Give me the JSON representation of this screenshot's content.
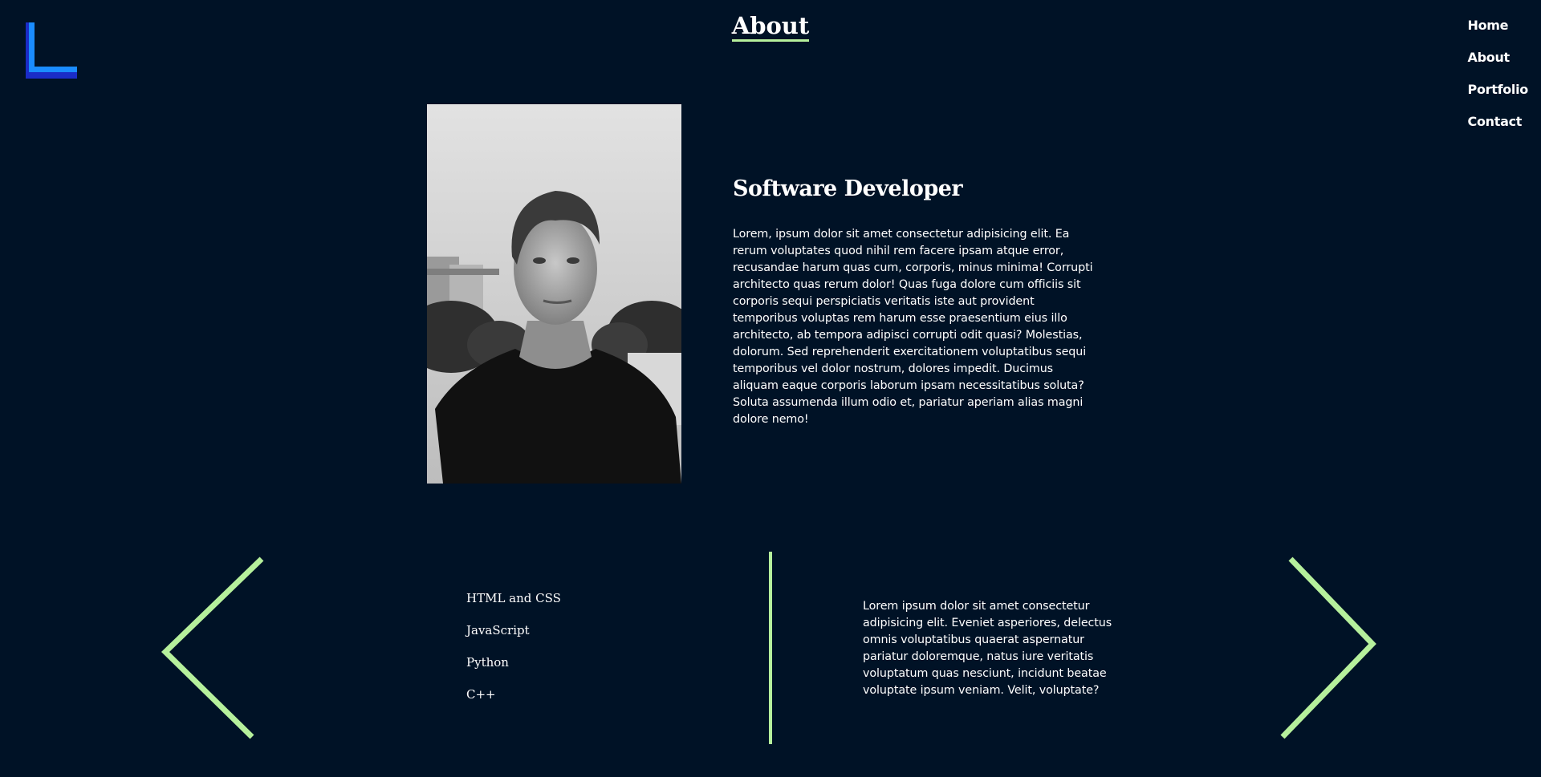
{
  "header": {
    "title": "About",
    "logo_icon": "l-logo-icon"
  },
  "nav": {
    "items": [
      {
        "label": "Home"
      },
      {
        "label": "About"
      },
      {
        "label": "Portfolio"
      },
      {
        "label": "Contact"
      }
    ]
  },
  "bio": {
    "heading": "Software Developer",
    "text": "Lorem, ipsum dolor sit amet consectetur adipisicing elit. Ea rerum voluptates quod nihil rem facere ipsam atque error, recusandae harum quas cum, corporis, minus minima! Corrupti architecto quas rerum dolor! Quas fuga dolore cum officiis sit corporis sequi perspiciatis veritatis iste aut provident temporibus voluptas rem harum esse praesentium eius illo architecto, ab tempora adipisci corrupti odit quasi? Molestias, dolorum. Sed reprehenderit exercitationem voluptatibus sequi temporibus vel dolor nostrum, dolores impedit. Ducimus aliquam eaque corporis laborum ipsam necessitatibus soluta? Soluta assumenda illum odio et, pariatur aperiam alias magni dolore nemo!"
  },
  "skills": {
    "items": [
      {
        "label": "HTML and CSS"
      },
      {
        "label": "JavaScript"
      },
      {
        "label": "Python"
      },
      {
        "label": "C++"
      }
    ],
    "description": "Lorem ipsum dolor sit amet consectetur adipisicing elit. Eveniet asperiores, delectus omnis voluptatibus quaerat aspernatur pariatur doloremque, natus iure veritatis voluptatum quas nesciunt, incidunt beatae voluptate ipsum veniam. Velit, voluptate?"
  },
  "colors": {
    "background": "#001226",
    "accent": "#b6f09c",
    "logo_blue": "#1a8cff",
    "logo_dark_blue": "#1a2cc7"
  },
  "icons": {
    "prev": "chevron-left-icon",
    "next": "chevron-right-icon"
  }
}
